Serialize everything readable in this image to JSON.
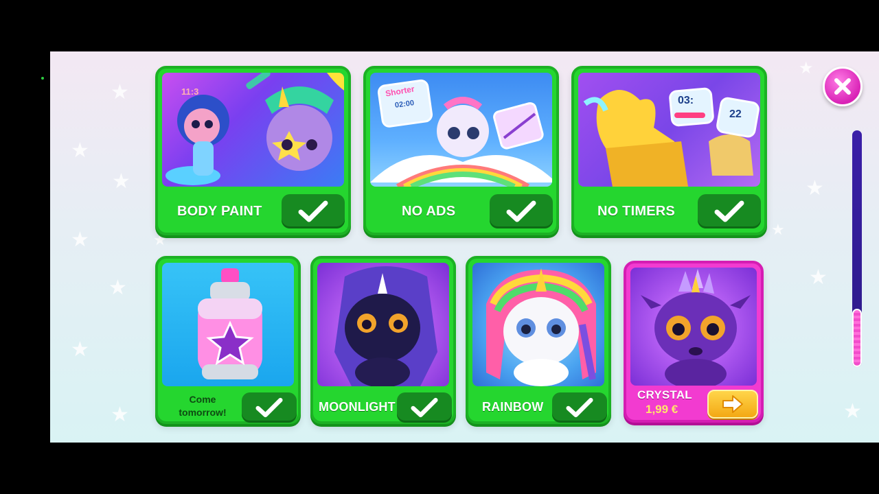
{
  "offers": {
    "body_paint": {
      "label": "BODY PAINT",
      "art_timer": "11:3",
      "check_icon": "checkmark-icon"
    },
    "no_ads": {
      "label": "NO ADS",
      "art_badge": "Shorter",
      "art_timer": "02:00",
      "check_icon": "checkmark-icon"
    },
    "no_timers": {
      "label": "NO TIMERS",
      "art_timer_left": "03:",
      "art_timer_right": "22",
      "check_icon": "checkmark-icon"
    },
    "spray": {
      "label": "Come tomorrow!",
      "label_line1": "Come",
      "label_line2": "tomorrow!",
      "check_icon": "checkmark-icon"
    },
    "moonlight": {
      "label": "MOONLIGHT",
      "check_icon": "checkmark-icon"
    },
    "rainbow": {
      "label": "RAINBOW",
      "check_icon": "checkmark-icon"
    },
    "crystal": {
      "label": "CRYSTAL",
      "price": "1,99 €",
      "buy_icon": "arrow-right-icon"
    }
  },
  "close_button": {
    "icon": "close-icon"
  },
  "scroll": {
    "position": 1.0
  },
  "colors": {
    "card_green": "#25d62f",
    "button_green": "#178a21",
    "card_pink": "#f23bd0",
    "close_pink": "#d923b6",
    "price_yellow": "#ffe76a",
    "scroll_track": "#3a1fa8"
  }
}
